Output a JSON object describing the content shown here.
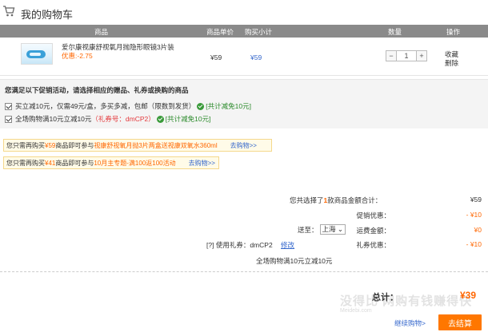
{
  "header": {
    "title": "我的购物车"
  },
  "table_header": {
    "product": "商品",
    "unit_price": "商品单价",
    "subtotal": "购买小计",
    "quantity": "数量",
    "actions": "操作"
  },
  "product": {
    "name": "爱尔康视康舒视氧月抛隐形眼镜3片装",
    "discount": "优惠:-2.75",
    "unit_price": "¥59",
    "subtotal": "¥59",
    "qty_minus": "−",
    "qty_value": "1",
    "qty_plus": "+",
    "action_favorite": "收藏",
    "action_delete": "删除"
  },
  "promo": {
    "title": "您满足以下促销活动，请选择相应的赠品、礼券或换购的商品",
    "line1_text": "买立减10元，仅需49元/盒，多买多减，包邮（限数到发货）",
    "line1_result": "[共计减免10元]",
    "line2_text": "全场购物满10元立减10元",
    "line2_coupon": "（礼券号：dmCP2）",
    "line2_result": "[共计减免10元]"
  },
  "notices": [
    {
      "prefix": "您只需再购买",
      "amount": "¥59",
      "mid": "商品即可参与",
      "promo": "视康舒视氧月抛3片两盒送视康双氧水360ml",
      "link": "去购物>>"
    },
    {
      "prefix": "您只需再购买",
      "amount": "¥41",
      "mid": "商品即可参与",
      "promo": "10月主专题-满100返100活动",
      "link": "去购物>>"
    }
  ],
  "summary": {
    "selected_prefix": "您共选择了",
    "selected_count": "1",
    "selected_suffix": "款商品金额合计：",
    "selected_value": "¥59",
    "discount_label": "促销优惠：",
    "discount_value": "- ¥10",
    "shipping_to": "送至：",
    "region": "上海",
    "shipping_label": "运费金额：",
    "shipping_value": "¥0",
    "coupon_help": "[?]",
    "coupon_text": "使用礼券：dmCP2",
    "coupon_edit": "修改",
    "coupon_label": "礼券优惠：",
    "coupon_value": "- ¥10",
    "coupon_desc": "全场购物满10元立减10元",
    "total_label": "总计：",
    "total_value": "¥39"
  },
  "watermark": {
    "main": "没得比 网购有钱赚得快",
    "sub": "Meidebi.com"
  },
  "buttons": {
    "continue": "继续购物>",
    "checkout": "去结算"
  },
  "colors": {
    "accent": "#ff6600",
    "link": "#3366cc",
    "header_bg": "#8a8a8a",
    "checkout": "#ff7700"
  }
}
